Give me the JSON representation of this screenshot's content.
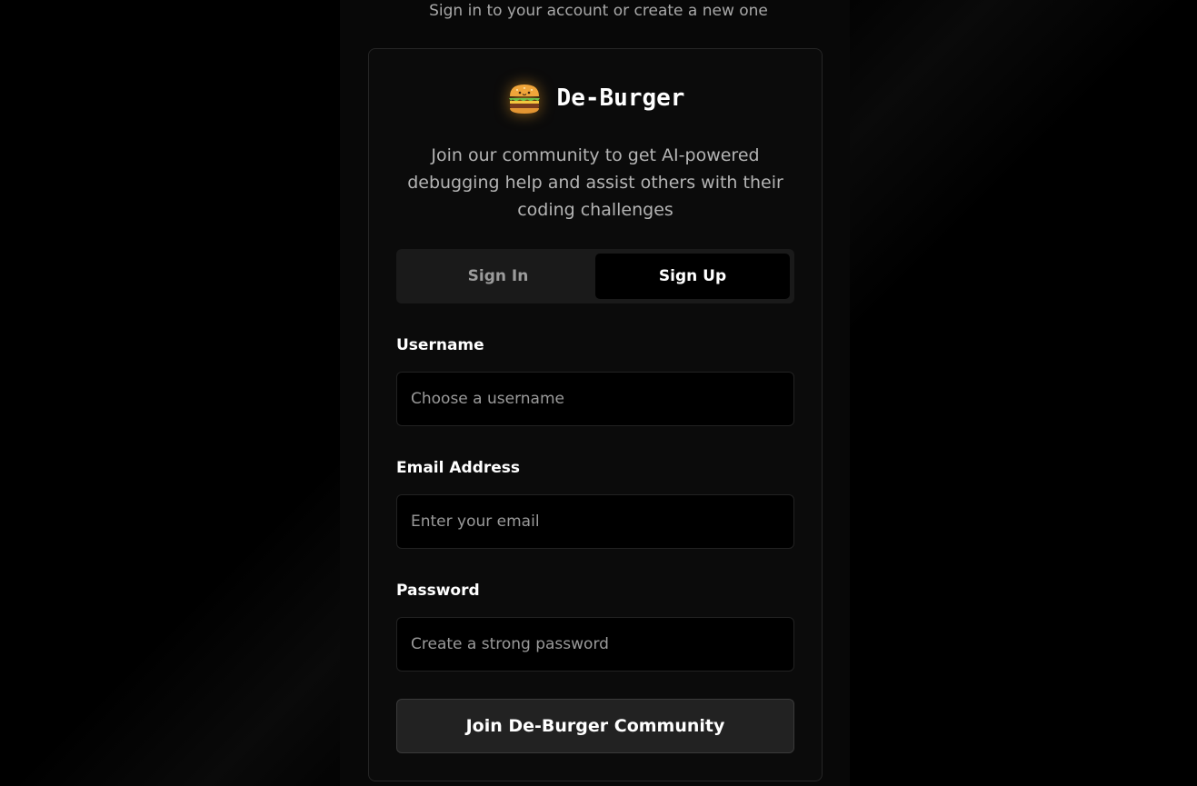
{
  "header": {
    "subtitle": "Sign in to your account or create a new one"
  },
  "brand": {
    "icon": "burger-icon",
    "name": "De-Burger",
    "tagline": "Join our community to get AI-powered debugging help and assist others with their coding challenges"
  },
  "tabs": [
    {
      "label": "Sign In",
      "active": false
    },
    {
      "label": "Sign Up",
      "active": true
    }
  ],
  "form": {
    "username": {
      "label": "Username",
      "value": "",
      "placeholder": "Choose a username"
    },
    "email": {
      "label": "Email Address",
      "value": "",
      "placeholder": "Enter your email"
    },
    "password": {
      "label": "Password",
      "value": "",
      "placeholder": "Create a strong password"
    },
    "submit_label": "Join De-Burger Community"
  },
  "colors": {
    "background": "#000000",
    "card": "#0b0b0b",
    "tab_active": "#000000",
    "button": "#222222",
    "icon_glow": "#ffaa28"
  }
}
